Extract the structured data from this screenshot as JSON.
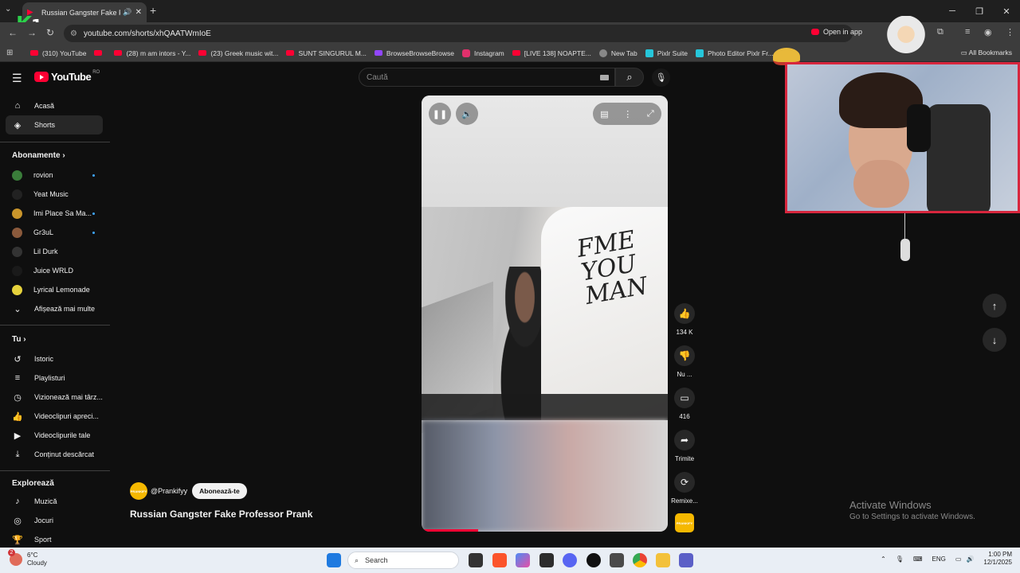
{
  "browser": {
    "tab_title": "Russian Gangster Fake Prof…",
    "url": "youtube.com/shorts/xhQAATWmIoE",
    "open_in_app": "Open in app",
    "all_bookmarks": "All Bookmarks",
    "bookmarks": [
      {
        "label": "(310) YouTube",
        "icon": "youtube"
      },
      {
        "label": "",
        "icon": "youtube"
      },
      {
        "label": "(28) m am intors - Y...",
        "icon": "youtube"
      },
      {
        "label": "(23) Greek music wit...",
        "icon": "youtube"
      },
      {
        "label": "SUNT SINGURUL M...",
        "icon": "youtube"
      },
      {
        "label": "BrowseBrowseBrowse",
        "icon": "twitch"
      },
      {
        "label": "Instagram",
        "icon": "instagram"
      },
      {
        "label": "[LIVE 138] NOAPTE...",
        "icon": "youtube"
      },
      {
        "label": "New Tab",
        "icon": "globe"
      },
      {
        "label": "Pixlr Suite",
        "icon": "pixlr"
      },
      {
        "label": "Photo Editor Pixlr Fr...",
        "icon": "pixlr"
      }
    ]
  },
  "overlay": {
    "logo_letter": "K",
    "logo_number": "1"
  },
  "youtube": {
    "logo_text": "YouTube",
    "country": "RO",
    "search_placeholder": "Caută",
    "sidebar": {
      "main": [
        {
          "label": "Acasă",
          "icon": "home-icon",
          "active": false
        },
        {
          "label": "Shorts",
          "icon": "shorts-icon",
          "active": true
        }
      ],
      "subscriptions_title": "Abonamente",
      "subscriptions": [
        {
          "label": "rovion",
          "color": "#3a7d3a",
          "dot": true
        },
        {
          "label": "Yeat Music",
          "color": "#222222",
          "dot": false
        },
        {
          "label": "Imi Place Sa Ma...",
          "color": "#c9952b",
          "dot": true
        },
        {
          "label": "Gr3uL",
          "color": "#8b5a3c",
          "dot": true
        },
        {
          "label": "Lil Durk",
          "color": "#333333",
          "dot": false
        },
        {
          "label": "Juice WRLD",
          "color": "#1a1a1a",
          "dot": false
        },
        {
          "label": "Lyrical Lemonade",
          "color": "#e6d23c",
          "dot": false
        }
      ],
      "show_more": "Afișează mai multe",
      "you_title": "Tu",
      "you": [
        {
          "label": "Istoric",
          "icon": "history-icon"
        },
        {
          "label": "Playlisturi",
          "icon": "playlists-icon"
        },
        {
          "label": "Vizionează mai târz...",
          "icon": "watch-later-icon"
        },
        {
          "label": "Videoclipuri apreci...",
          "icon": "liked-icon"
        },
        {
          "label": "Videoclipurile tale",
          "icon": "your-videos-icon"
        },
        {
          "label": "Conținut descărcat",
          "icon": "downloads-icon"
        }
      ],
      "explore_title": "Explorează",
      "explore": [
        {
          "label": "Muzică",
          "icon": "music-icon"
        },
        {
          "label": "Jocuri",
          "icon": "gaming-icon"
        },
        {
          "label": "Sport",
          "icon": "sports-icon"
        }
      ]
    },
    "short": {
      "channel_handle": "@Prankifyy",
      "channel_avatar_text": "PRANKIFY",
      "subscribe_label": "Abonează-te",
      "title": "Russian Gangster Fake Professor Prank",
      "video_text": "FME YOU MAN",
      "progress": 0.23
    },
    "actions": {
      "likes": "134 K",
      "dislike": "Nu ...",
      "comments": "416",
      "share": "Trimite",
      "remix": "Remixe..."
    }
  },
  "windows": {
    "activate_title": "Activate Windows",
    "activate_sub": "Go to Settings to activate Windows.",
    "weather_temp": "6°C",
    "weather_desc": "Cloudy",
    "weather_badge": "2",
    "search_label": "Search",
    "language": "ENG",
    "time": "1:00 PM",
    "date": "12/1/2025"
  }
}
